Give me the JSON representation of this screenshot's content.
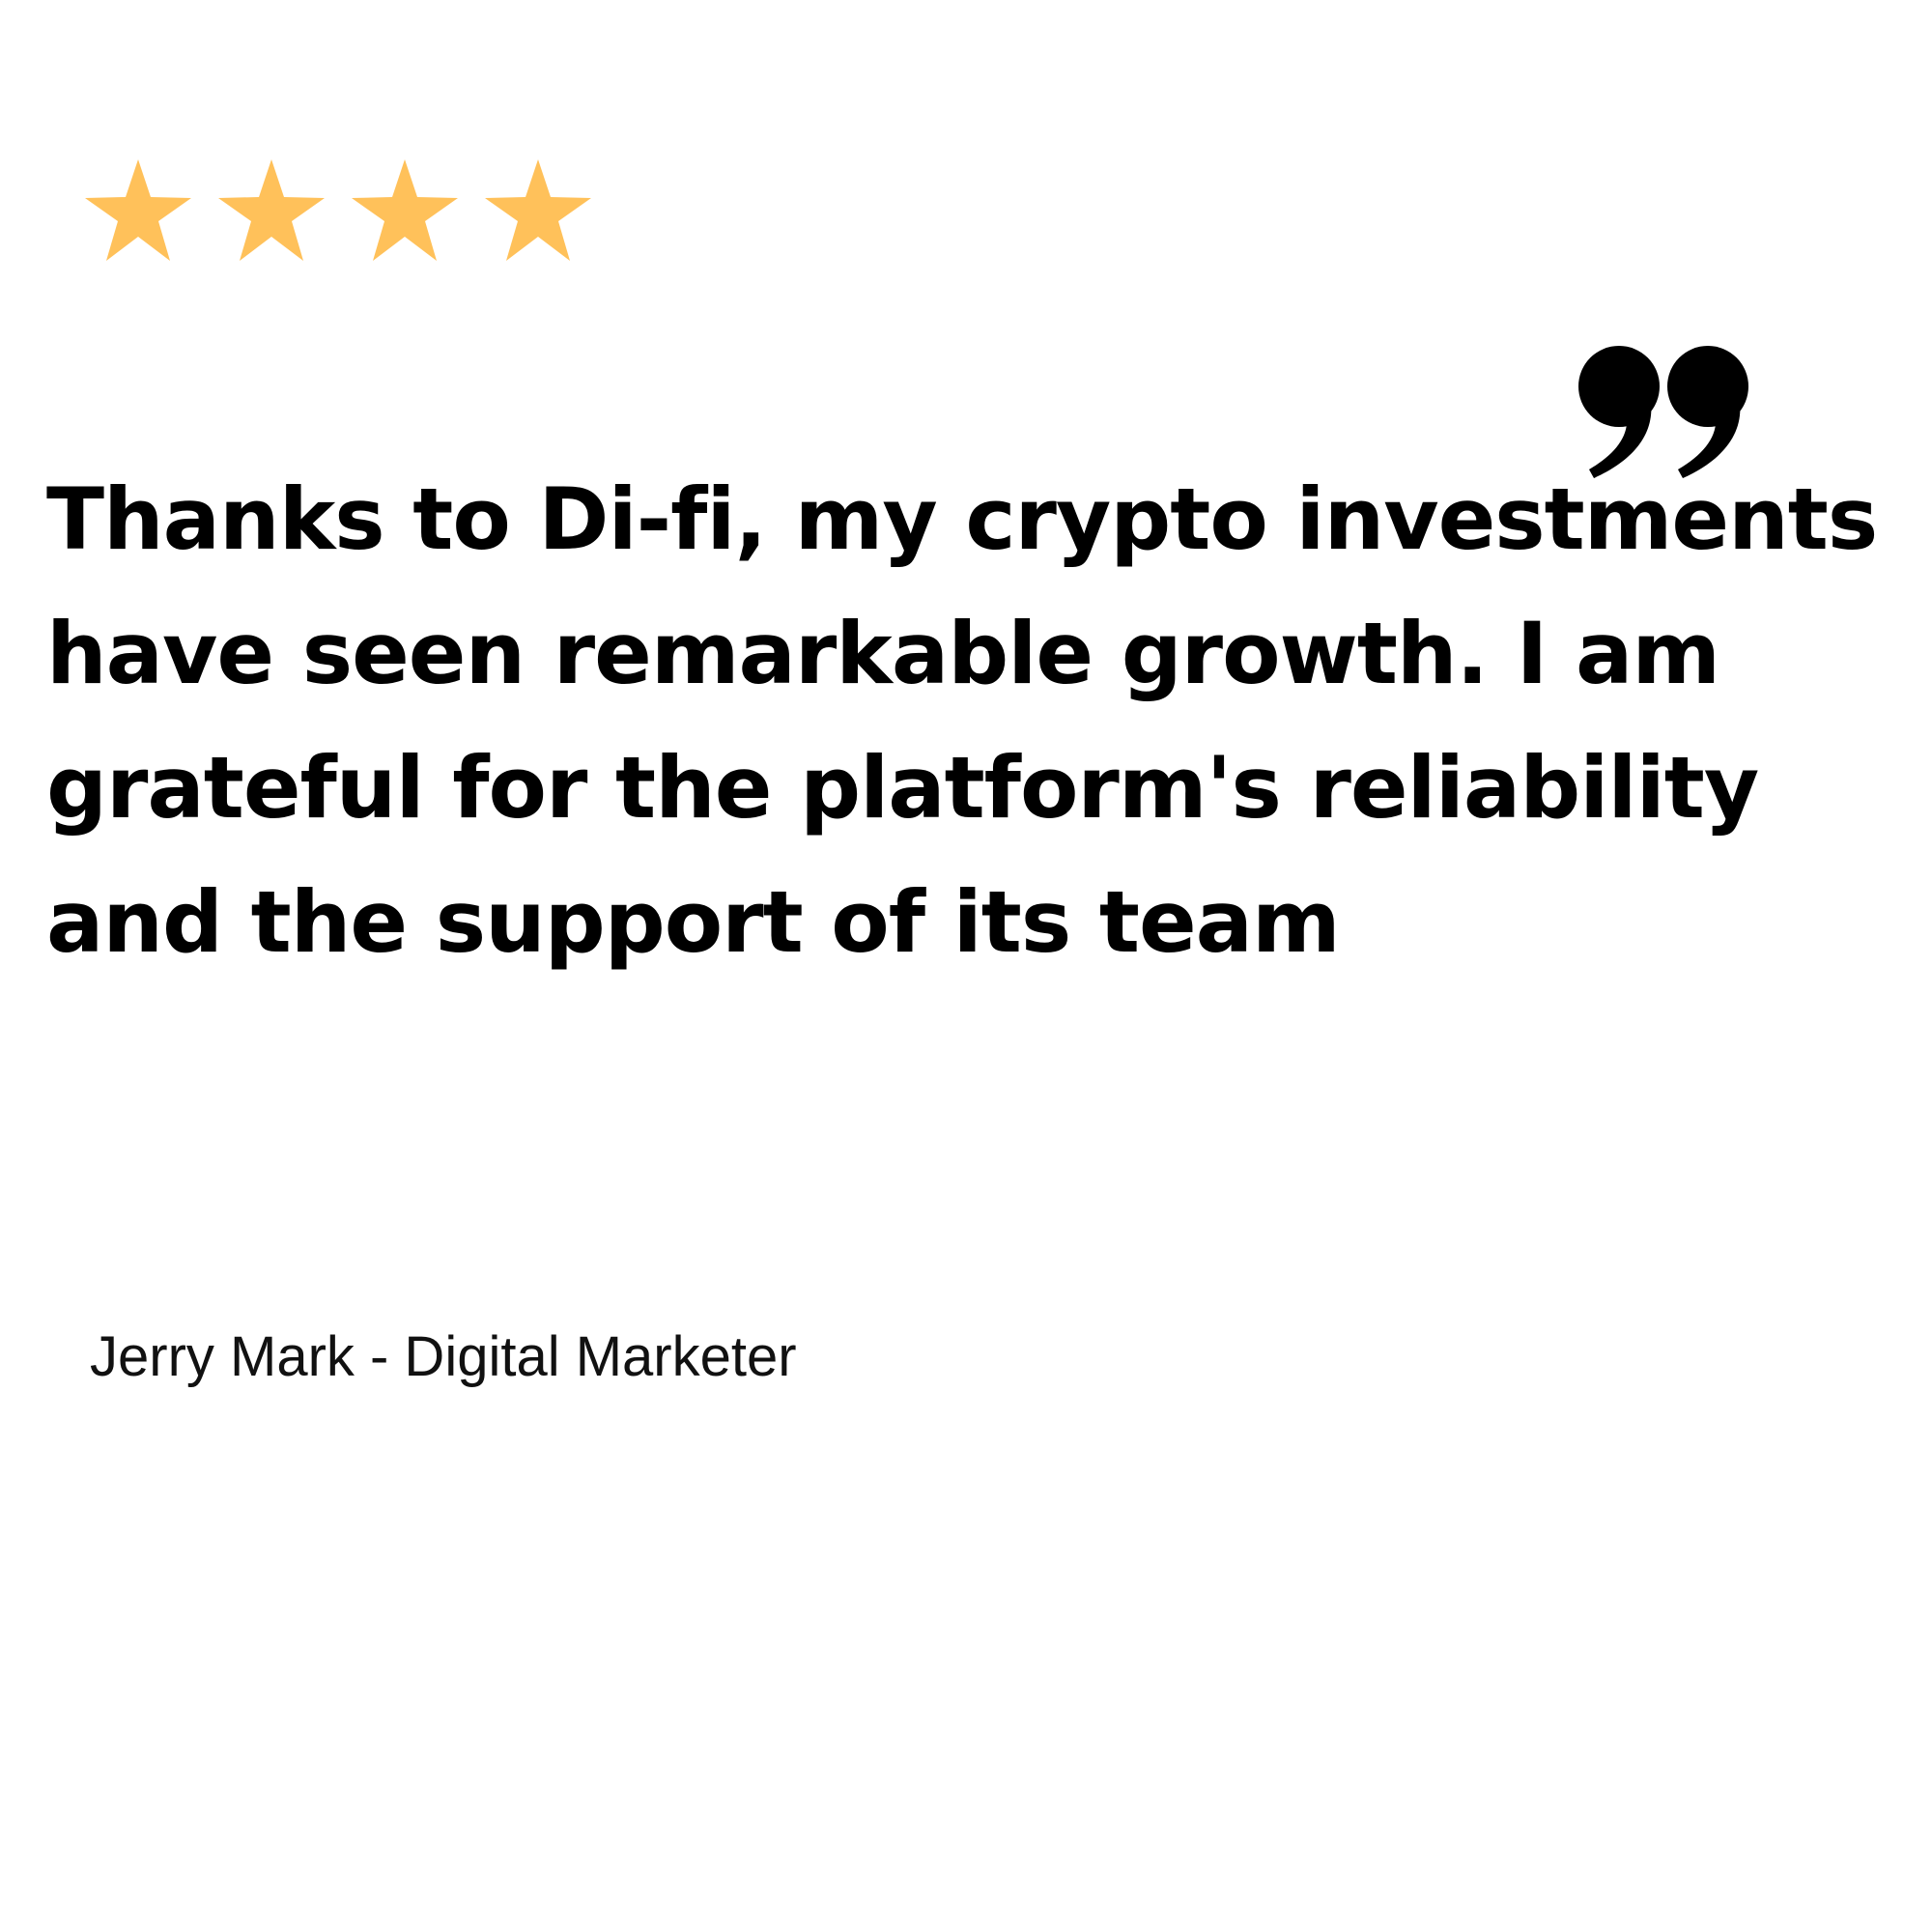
{
  "rating": {
    "stars": 4,
    "star_color": "#FFC15A",
    "icon": "star-icon"
  },
  "quote_icon": "closing-quote-icon",
  "testimonial": {
    "text": "Thanks to Di-fi, my crypto investments have seen remarkable growth. I am grateful for the platform's reliability and the support of its team",
    "attribution": "Jerry Mark - Digital Marketer"
  },
  "colors": {
    "text": "#000000",
    "background": "#FFFFFF"
  }
}
